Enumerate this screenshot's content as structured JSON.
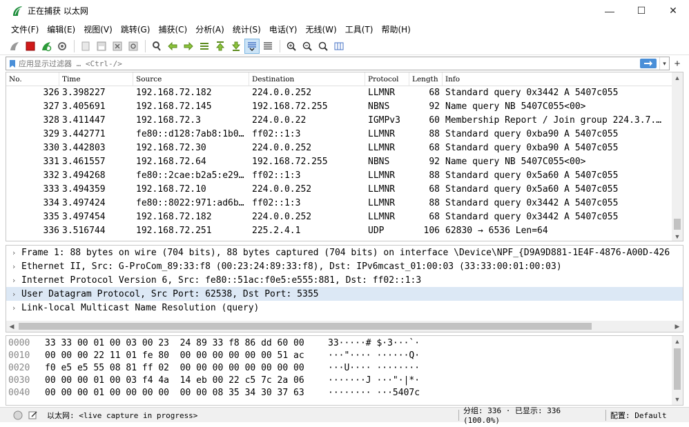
{
  "window": {
    "title": "正在捕获 以太网",
    "minimize": "—",
    "maximize": "☐",
    "close": "✕"
  },
  "menu": [
    "文件(F)",
    "编辑(E)",
    "视图(V)",
    "跳转(G)",
    "捕获(C)",
    "分析(A)",
    "统计(S)",
    "电话(Y)",
    "无线(W)",
    "工具(T)",
    "帮助(H)"
  ],
  "toolbar": {
    "icons": [
      "shark-fin-start-icon",
      "stop-capture-icon",
      "restart-capture-icon",
      "capture-options-icon",
      "open-file-icon",
      "save-file-icon",
      "close-file-icon",
      "reload-file-icon",
      "find-packet-icon",
      "go-back-icon",
      "go-forward-icon",
      "go-to-packet-icon",
      "go-first-icon",
      "go-last-icon",
      "autoscroll-icon",
      "colorize-icon",
      "zoom-in-icon",
      "zoom-out-icon",
      "zoom-normal-icon",
      "resize-columns-icon"
    ]
  },
  "filter": {
    "placeholder": "应用显示过滤器 … <Ctrl-/>",
    "plus": "+"
  },
  "packet_list": {
    "columns": [
      "No.",
      "Time",
      "Source",
      "Destination",
      "Protocol",
      "Length",
      "Info"
    ],
    "rows": [
      {
        "no": "326",
        "time": "3.398227",
        "src": "192.168.72.182",
        "dst": "224.0.0.252",
        "proto": "LLMNR",
        "len": "68",
        "info": "Standard query 0x3442 A 5407c055"
      },
      {
        "no": "327",
        "time": "3.405691",
        "src": "192.168.72.145",
        "dst": "192.168.72.255",
        "proto": "NBNS",
        "len": "92",
        "info": "Name query NB 5407C055<00>"
      },
      {
        "no": "328",
        "time": "3.411447",
        "src": "192.168.72.3",
        "dst": "224.0.0.22",
        "proto": "IGMPv3",
        "len": "60",
        "info": "Membership Report / Join group 224.3.7.…"
      },
      {
        "no": "329",
        "time": "3.442771",
        "src": "fe80::d128:7ab8:1b0…",
        "dst": "ff02::1:3",
        "proto": "LLMNR",
        "len": "88",
        "info": "Standard query 0xba90 A 5407c055"
      },
      {
        "no": "330",
        "time": "3.442803",
        "src": "192.168.72.30",
        "dst": "224.0.0.252",
        "proto": "LLMNR",
        "len": "68",
        "info": "Standard query 0xba90 A 5407c055"
      },
      {
        "no": "331",
        "time": "3.461557",
        "src": "192.168.72.64",
        "dst": "192.168.72.255",
        "proto": "NBNS",
        "len": "92",
        "info": "Name query NB 5407C055<00>"
      },
      {
        "no": "332",
        "time": "3.494268",
        "src": "fe80::2cae:b2a5:e29…",
        "dst": "ff02::1:3",
        "proto": "LLMNR",
        "len": "88",
        "info": "Standard query 0x5a60 A 5407c055"
      },
      {
        "no": "333",
        "time": "3.494359",
        "src": "192.168.72.10",
        "dst": "224.0.0.252",
        "proto": "LLMNR",
        "len": "68",
        "info": "Standard query 0x5a60 A 5407c055"
      },
      {
        "no": "334",
        "time": "3.497424",
        "src": "fe80::8022:971:ad6b…",
        "dst": "ff02::1:3",
        "proto": "LLMNR",
        "len": "88",
        "info": "Standard query 0x3442 A 5407c055"
      },
      {
        "no": "335",
        "time": "3.497454",
        "src": "192.168.72.182",
        "dst": "224.0.0.252",
        "proto": "LLMNR",
        "len": "68",
        "info": "Standard query 0x3442 A 5407c055"
      },
      {
        "no": "336",
        "time": "3.516744",
        "src": "192.168.72.251",
        "dst": "225.2.4.1",
        "proto": "UDP",
        "len": "106",
        "info": "62830 → 6536 Len=64"
      }
    ]
  },
  "details": [
    "Frame 1: 88 bytes on wire (704 bits), 88 bytes captured (704 bits) on interface \\Device\\NPF_{D9A9D881-1E4F-4876-A00D-426",
    "Ethernet II, Src: G-ProCom_89:33:f8 (00:23:24:89:33:f8), Dst: IPv6mcast_01:00:03 (33:33:00:01:00:03)",
    "Internet Protocol Version 6, Src: fe80::51ac:f0e5:e555:881, Dst: ff02::1:3",
    "User Datagram Protocol, Src Port: 62538, Dst Port: 5355",
    "Link-local Multicast Name Resolution (query)"
  ],
  "bytes": [
    {
      "off": "0000",
      "hex": "33 33 00 01 00 03 00 23  24 89 33 f8 86 dd 60 00",
      "ascii": "33·····# $·3···`·"
    },
    {
      "off": "0010",
      "hex": "00 00 00 22 11 01 fe 80  00 00 00 00 00 00 51 ac",
      "ascii": "···\"···· ······Q·"
    },
    {
      "off": "0020",
      "hex": "f0 e5 e5 55 08 81 ff 02  00 00 00 00 00 00 00 00",
      "ascii": "···U···· ········"
    },
    {
      "off": "0030",
      "hex": "00 00 00 01 00 03 f4 4a  14 eb 00 22 c5 7c 2a 06",
      "ascii": "·······J ···\"·|*·"
    },
    {
      "off": "0040",
      "hex": "00 00 00 01 00 00 00 00  00 00 08 35 34 30 37 63",
      "ascii": "········ ···5407c"
    }
  ],
  "status": {
    "capture": "以太网: <live capture in progress>",
    "packets": "分组: 336 · 已显示: 336 (100.0%)",
    "profile": "配置: Default"
  }
}
